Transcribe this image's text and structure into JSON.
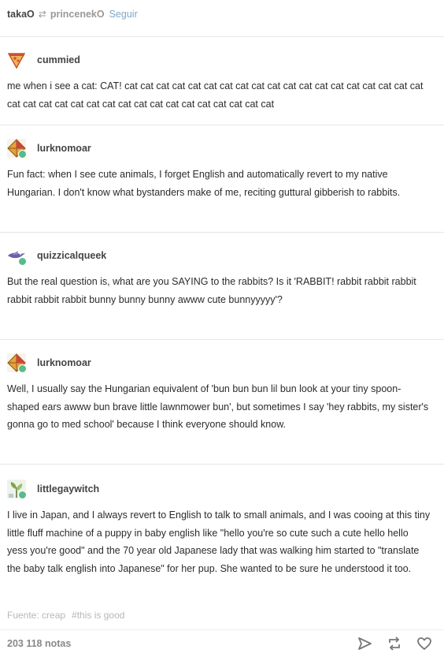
{
  "header": {
    "user": "takaO",
    "reblogged_from": "princenekO",
    "follow_label": "Seguir"
  },
  "posts": [
    {
      "username": "cummied",
      "avatar_icon": "pizza-slice-icon",
      "text": "me when i see a cat: CAT! cat cat cat cat cat cat cat cat cat cat cat cat cat cat cat cat cat cat cat cat cat cat cat cat cat cat cat cat cat cat cat cat cat cat cat cat"
    },
    {
      "username": "lurknomoar",
      "avatar_icon": "kite-icon",
      "text": "Fun fact: when I see cute animals, I forget English and automatically revert to my native Hungarian. I don't know what bystanders make of me, reciting guttural gibberish to rabbits."
    },
    {
      "username": "quizzicalqueek",
      "avatar_icon": "bird-icon",
      "text": "But the real question is, what are you SAYING to the rabbits? Is it 'RABBIT! rabbit rabbit rabbit rabbit rabbit rabbit bunny bunny bunny awww cute bunnyyyyy'?"
    },
    {
      "username": "lurknomoar",
      "avatar_icon": "kite-icon",
      "text": "Well, I usually say the Hungarian equivalent of 'bun bun bun lil bun look at your tiny spoon-shaped ears awww bun brave little lawnmower bun', but sometimes I say 'hey rabbits, my sister's gonna go to med school' because I think everyone should know."
    },
    {
      "username": "littlegaywitch",
      "avatar_icon": "plant-icon",
      "text": "I live in Japan, and I always revert to English to talk to small animals, and I was cooing at this tiny little fluff machine of a puppy in baby english like \"hello you're so cute such a cute hello hello yess you're good\" and the 70 year old Japanese lady that was walking him started to \"translate the baby talk english into Japanese\" for her pup. She wanted to be sure he understood it too."
    }
  ],
  "source": {
    "label": "Fuente: creap",
    "tag": "#this is good"
  },
  "footer": {
    "notes": "203 118 notas",
    "actions": [
      "share-icon",
      "reblog-icon",
      "heart-icon"
    ]
  },
  "colors": {
    "follow": "#7fa6c8",
    "badge": "#56bc8a",
    "muted": "#b7b7b7"
  }
}
